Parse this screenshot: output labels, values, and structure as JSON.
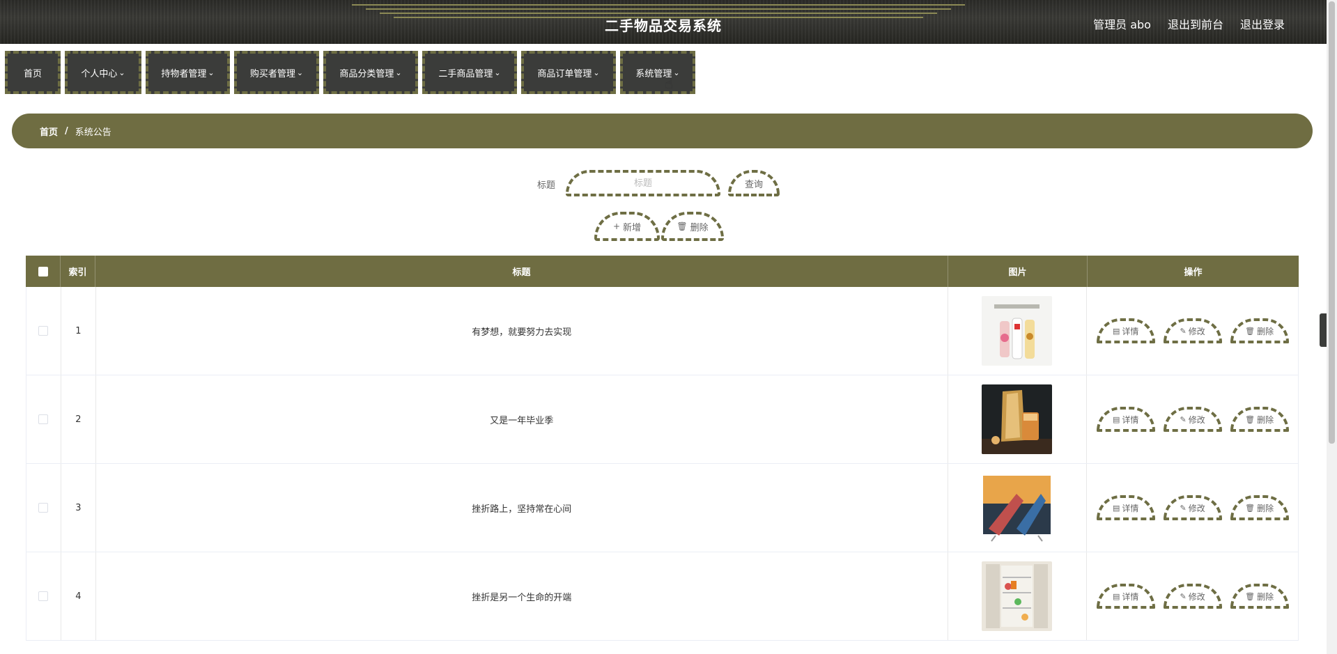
{
  "header": {
    "title": "二手物品交易系统",
    "links": [
      "管理员 abo",
      "退出到前台",
      "退出登录"
    ]
  },
  "nav": [
    {
      "label": "首页",
      "dropdown": false
    },
    {
      "label": "个人中心",
      "dropdown": true
    },
    {
      "label": "持物者管理",
      "dropdown": true
    },
    {
      "label": "购买者管理",
      "dropdown": true
    },
    {
      "label": "商品分类管理",
      "dropdown": true
    },
    {
      "label": "二手商品管理",
      "dropdown": true
    },
    {
      "label": "商品订单管理",
      "dropdown": true
    },
    {
      "label": "系统管理",
      "dropdown": true
    }
  ],
  "breadcrumb": {
    "home": "首页",
    "separator": "/",
    "current": "系统公告"
  },
  "search": {
    "label": "标题",
    "placeholder": "标题",
    "query_button": "查询",
    "add_button": "新增",
    "delete_button": "删除"
  },
  "table": {
    "headers": {
      "index": "索引",
      "title": "标题",
      "image": "图片",
      "ops": "操作"
    },
    "ops_labels": {
      "detail": "详情",
      "edit": "修改",
      "delete": "删除"
    },
    "rows": [
      {
        "index": "1",
        "title": "有梦想，就要努力去实现",
        "image": "bottled-drinks"
      },
      {
        "index": "2",
        "title": "又是一年毕业季",
        "image": "tea-drink"
      },
      {
        "index": "3",
        "title": "挫折路上，坚持常在心间",
        "image": "tv-screen"
      },
      {
        "index": "4",
        "title": "挫折是另一个生命的开端",
        "image": "refrigerator"
      }
    ]
  },
  "colors": {
    "accent": "#6f6d42",
    "dashed_border": "#6e6e44",
    "nav_bg": "#3b3c3a"
  }
}
